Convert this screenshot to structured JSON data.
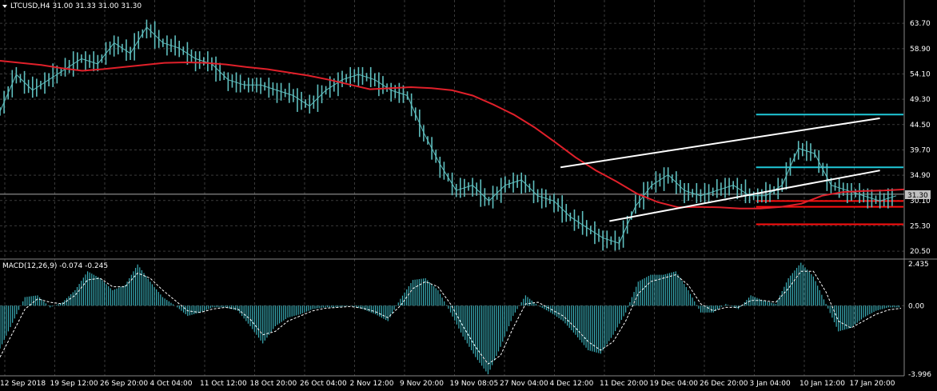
{
  "header": {
    "symbol_line": "LTCUSD,H4  31.00 31.33 31.00 31.30",
    "macd_line": "MACD(12,26,9) -0.074 -0.245"
  },
  "colors": {
    "background": "#000000",
    "grid": "#3a3a3a",
    "candles": "#5fbfbf",
    "ma": "#e0202a",
    "channel": "#ffffff",
    "levels_cyan": "#20c8d8",
    "levels_red": "#ff1010",
    "macd_hist": "#3aaeb8",
    "macd_signal": "#ffffff",
    "price_tag": "#c0c0c0"
  },
  "chart_data": [
    {
      "type": "line",
      "title": "LTCUSD,H4",
      "ohlc": {
        "open": 31.0,
        "high": 31.33,
        "low": 31.0,
        "close": 31.3
      },
      "x": [
        "12 Sep 2018",
        "19 Sep 12:00",
        "26 Sep 20:00",
        "4 Oct 04:00",
        "11 Oct 12:00",
        "18 Oct 20:00",
        "26 Oct 04:00",
        "2 Nov 12:00",
        "9 Nov 20:00",
        "19 Nov 08:05",
        "27 Nov 04:00",
        "4 Dec 12:00",
        "11 Dec 20:00",
        "19 Dec 04:00",
        "26 Dec 20:00",
        "3 Jan 04:00",
        "10 Jan 12:00",
        "17 Jan 20:00"
      ],
      "y_ticks": [
        "63.70",
        "58.90",
        "54.10",
        "49.30",
        "44.50",
        "39.70",
        "34.90",
        "30.10",
        "25.30",
        "20.50"
      ],
      "ylim": [
        19.3,
        66.0
      ],
      "current_price": "31.30",
      "series": [
        {
          "kind": "price",
          "values": [
            47,
            54,
            51,
            53,
            55,
            57,
            56,
            60,
            58,
            63,
            60,
            59,
            57,
            56,
            53,
            52,
            52,
            51,
            50,
            48,
            51,
            53,
            54,
            53,
            51,
            50,
            43,
            37,
            32,
            33,
            30,
            33,
            34,
            31,
            30,
            27,
            25,
            23,
            22,
            29,
            33,
            35,
            32,
            31,
            32,
            33,
            31,
            31,
            33,
            40,
            39,
            33,
            32,
            31,
            30,
            31
          ]
        },
        {
          "kind": "moving_average",
          "values": [
            56.6,
            56.2,
            55.8,
            55.2,
            54.7,
            55.0,
            55.4,
            55.8,
            56.2,
            56.3,
            56.2,
            55.9,
            55.4,
            55.0,
            54.4,
            53.8,
            53.0,
            52.1,
            51.2,
            51.4,
            51.6,
            51.4,
            51.0,
            50.0,
            48.3,
            46.4,
            44.0,
            41.2,
            38.3,
            35.8,
            33.7,
            31.4,
            29.8,
            28.8,
            28.9,
            28.8,
            28.6,
            28.6,
            28.9,
            29.5,
            31.0,
            31.7,
            31.9,
            32.0,
            32.2
          ]
        }
      ],
      "levels": {
        "cyan": [
          46.4,
          36.4
        ],
        "red": [
          30.0,
          28.9,
          25.6
        ]
      },
      "channel": {
        "upper_start": [
          34.4,
          36.4
        ],
        "upper_end": [
          54.0,
          45.7
        ],
        "lower_start": [
          37.4,
          26.2
        ],
        "lower_end": [
          54.0,
          35.8
        ]
      }
    },
    {
      "type": "bar",
      "title": "MACD(12,26,9)",
      "macd_value": "-0.074",
      "signal_value": "-0.245",
      "y_ticks": [
        "2.435",
        "0.00",
        "-3.996"
      ],
      "ylim": [
        -3.996,
        2.435
      ],
      "series": [
        {
          "name": "MACD",
          "values": [
            -2.5,
            -1.0,
            0.5,
            0.6,
            -0.1,
            0.2,
            0.9,
            2.0,
            1.6,
            0.9,
            1.2,
            2.4,
            1.4,
            0.5,
            0.0,
            -0.6,
            -0.4,
            -0.1,
            -0.1,
            -0.3,
            -1.2,
            -2.2,
            -1.2,
            -0.7,
            -0.5,
            -0.2,
            -0.1,
            -0.1,
            0.0,
            -0.2,
            -0.5,
            -0.9,
            0.4,
            1.5,
            1.6,
            0.9,
            -0.4,
            -1.8,
            -3.0,
            -4.0,
            -2.4,
            -0.6,
            0.6,
            0.0,
            -0.4,
            -0.9,
            -1.7,
            -2.6,
            -2.8,
            -1.7,
            -0.4,
            1.4,
            1.8,
            1.8,
            2.0,
            0.9,
            -0.4,
            -0.4,
            0.1,
            -0.2,
            0.6,
            0.3,
            0.1,
            1.6,
            2.5,
            1.7,
            0.1,
            -1.5,
            -1.3,
            -0.7,
            -0.3,
            -0.1,
            -0.1
          ]
        },
        {
          "name": "Signal",
          "values": [
            -3.0,
            -1.6,
            -0.2,
            0.4,
            0.2,
            0.1,
            0.6,
            1.5,
            1.6,
            1.1,
            1.1,
            1.9,
            1.6,
            0.9,
            0.3,
            -0.3,
            -0.4,
            -0.2,
            -0.1,
            -0.2,
            -0.8,
            -1.7,
            -1.5,
            -0.9,
            -0.6,
            -0.3,
            -0.15,
            -0.1,
            -0.05,
            -0.15,
            -0.35,
            -0.7,
            0.0,
            1.0,
            1.4,
            1.1,
            0.1,
            -1.2,
            -2.4,
            -3.4,
            -2.9,
            -1.3,
            0.1,
            0.2,
            -0.2,
            -0.6,
            -1.3,
            -2.1,
            -2.6,
            -2.1,
            -0.9,
            0.7,
            1.4,
            1.6,
            1.8,
            1.2,
            0.1,
            -0.3,
            -0.1,
            -0.1,
            0.3,
            0.3,
            0.2,
            1.0,
            2.0,
            2.0,
            0.8,
            -0.9,
            -1.3,
            -0.9,
            -0.5,
            -0.25,
            -0.15
          ]
        }
      ]
    }
  ]
}
